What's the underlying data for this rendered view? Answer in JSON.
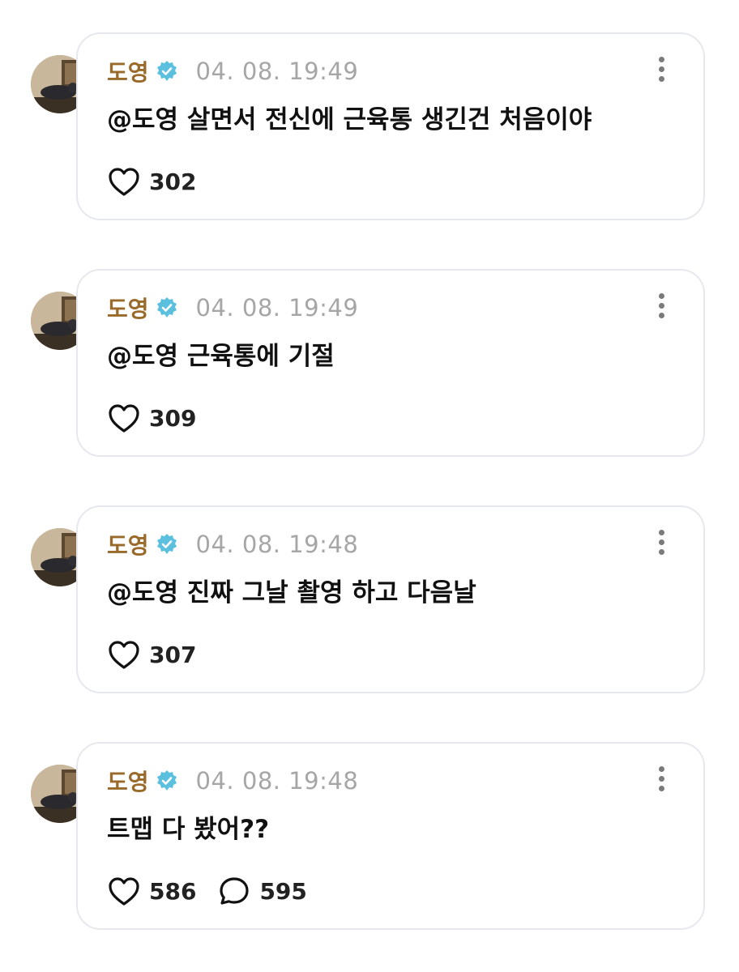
{
  "comments": [
    {
      "username": "도영",
      "verified_icon": "verified-badge-icon",
      "timestamp": "04. 08. 19:49",
      "text": "@도영 살면서 전신에 근육통 생긴건 처음이야",
      "likes": "302",
      "replies": null
    },
    {
      "username": "도영",
      "verified_icon": "verified-badge-icon",
      "timestamp": "04. 08. 19:49",
      "text": "@도영 근육통에 기절",
      "likes": "309",
      "replies": null
    },
    {
      "username": "도영",
      "verified_icon": "verified-badge-icon",
      "timestamp": "04. 08. 19:48",
      "text": "@도영 진짜 그날 촬영 하고 다음날",
      "likes": "307",
      "replies": null
    },
    {
      "username": "도영",
      "verified_icon": "verified-badge-icon",
      "timestamp": "04. 08. 19:48",
      "text": "트맵 다 봤어??",
      "likes": "586",
      "replies": "595"
    }
  ],
  "colors": {
    "username": "#9a6a2a",
    "verified": "#5bc0de",
    "timestamp": "#a6a6a6",
    "card_border": "#e7e8ee"
  }
}
